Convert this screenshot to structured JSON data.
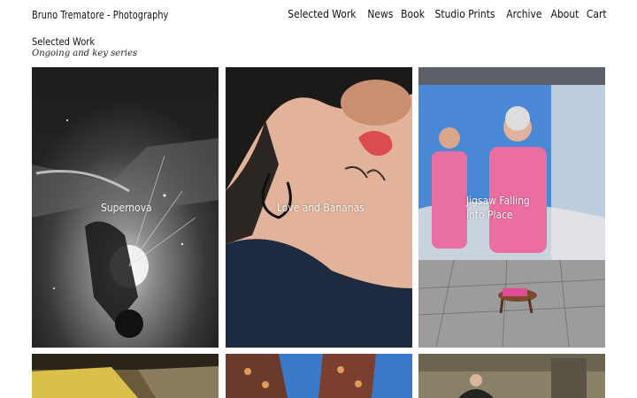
{
  "site": {
    "title": "Bruno Trematore - Photography"
  },
  "nav": {
    "items": [
      "Selected Work",
      "News",
      "Book",
      "Studio Prints",
      "Archive",
      "About",
      "Cart"
    ]
  },
  "section": {
    "title": "Selected Work",
    "subtitle": "Ongoing and key series"
  },
  "gallery": {
    "items": [
      {
        "label": "Supernova"
      },
      {
        "label": "Love and Bananas"
      },
      {
        "label": "Jigsaw Falling into Place"
      },
      {
        "label": ""
      },
      {
        "label": ""
      },
      {
        "label": ""
      }
    ]
  }
}
